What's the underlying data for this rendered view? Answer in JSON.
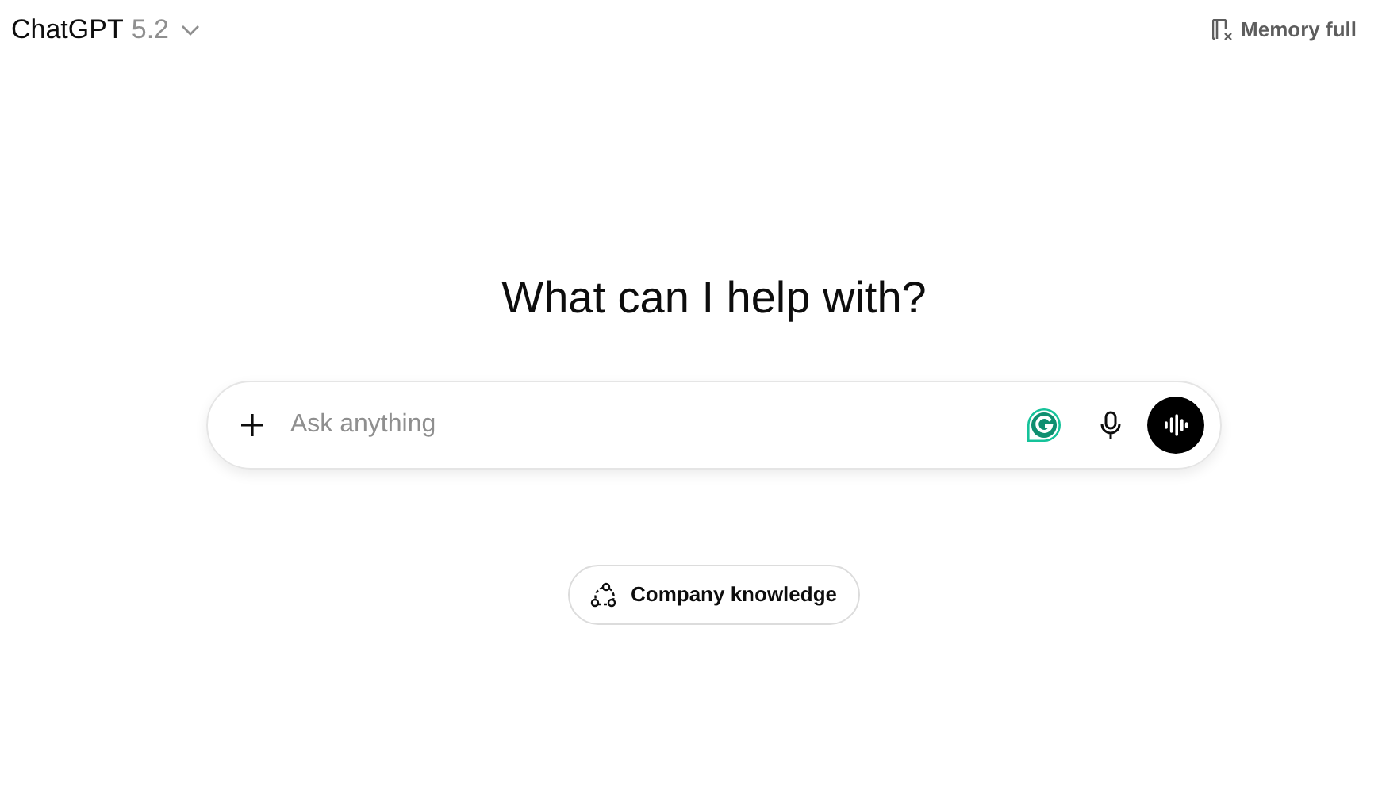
{
  "header": {
    "model_name": "ChatGPT",
    "model_version": "5.2",
    "memory_status": "Memory full"
  },
  "heading": "What can I help with?",
  "composer": {
    "placeholder": "Ask anything"
  },
  "suggestions": [
    {
      "label": "Company knowledge"
    }
  ]
}
